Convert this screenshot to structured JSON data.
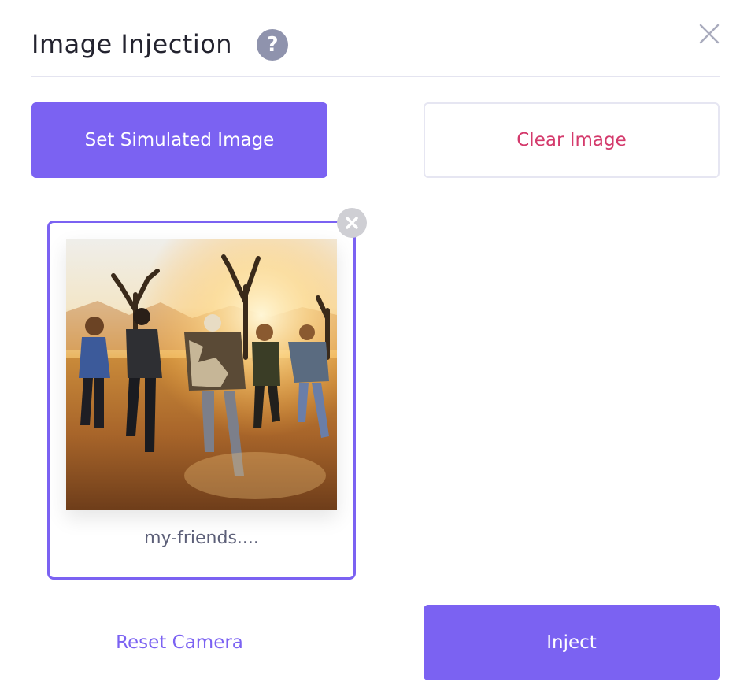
{
  "dialog": {
    "title": "Image Injection",
    "help_icon": "question-mark-icon",
    "help_glyph": "?",
    "close_icon": "close-icon"
  },
  "actions": {
    "set_image_label": "Set Simulated Image",
    "clear_image_label": "Clear Image",
    "reset_camera_label": "Reset Camera",
    "inject_label": "Inject"
  },
  "image_card": {
    "file_name": "my-friends....",
    "selected": true,
    "remove_icon": "remove-x-icon"
  },
  "colors": {
    "accent": "#7b62f2",
    "danger_text": "#d43a6c",
    "help_icon_bg": "#8f93ad",
    "divider": "#e4e4f0"
  }
}
